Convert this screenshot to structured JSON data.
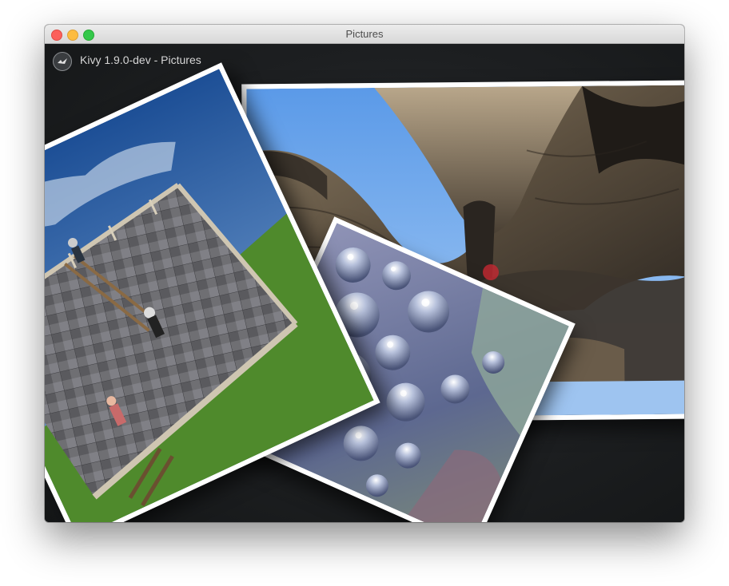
{
  "window": {
    "title": "Pictures",
    "app_title": "Kivy 1.9.0-dev - Pictures",
    "logo_icon": "kivy-logo-icon",
    "controls": [
      "close-button",
      "minimize-button",
      "zoom-button"
    ]
  },
  "colors": {
    "canvas_background": "#1d1f21",
    "photo_border": "#ffffff",
    "touch_indicator": "#c82832"
  },
  "pictures": [
    {
      "id": "cathedral-arches",
      "subject": "stone arches against blue sky"
    },
    {
      "id": "blue-flowers",
      "subject": "pearly blue abstract flowers"
    },
    {
      "id": "escher-rooftop",
      "subject": "impossible rooftop terrace with ladder"
    }
  ]
}
